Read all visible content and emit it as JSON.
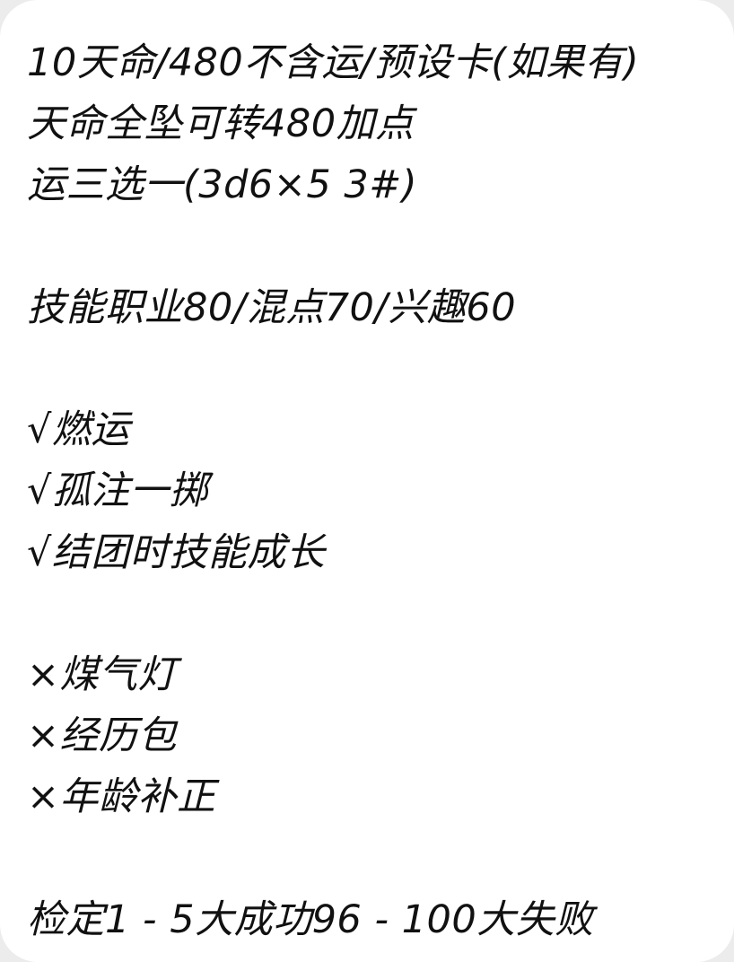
{
  "message": {
    "lines": [
      "10天命/480不含运/预设卡(如果有)",
      "天命全坠可转480加点",
      "运三选一(3d6×5 3#)",
      "",
      "技能职业80/混点70/兴趣60",
      "",
      "√燃运",
      "√孤注一掷",
      "√结团时技能成长",
      "",
      "×煤气灯",
      "×经历包",
      "×年龄补正",
      "",
      "检定1 - 5大成功96 - 100大失败"
    ]
  }
}
